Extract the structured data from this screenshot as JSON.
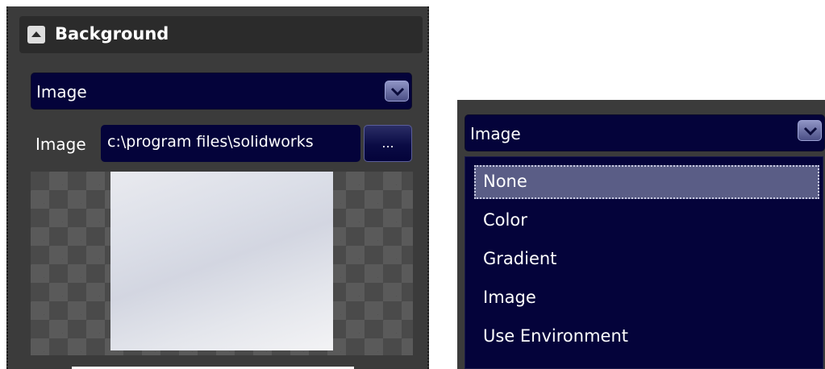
{
  "left_panel": {
    "section_title": "Background",
    "background_type": "Image",
    "image_label": "Image",
    "image_path": "c:\\program files\\solidworks",
    "browse_label": "..."
  },
  "right_panel": {
    "selected_value": "Image",
    "options": [
      "None",
      "Color",
      "Gradient",
      "Image",
      "Use Environment"
    ],
    "highlighted_option": "None"
  },
  "colors": {
    "panel_bg": "#3b3b3b",
    "field_bg": "#04033a",
    "highlight_bg": "#5a5d86"
  }
}
